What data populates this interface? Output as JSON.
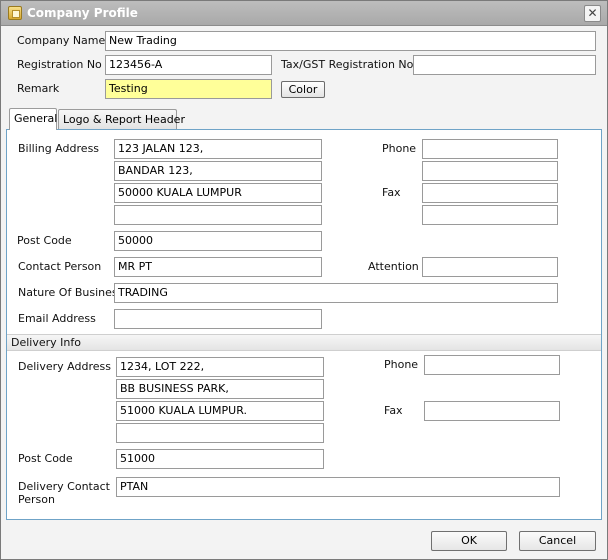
{
  "window": {
    "title": "Company Profile",
    "close_glyph": "✕"
  },
  "header": {
    "company_name_label": "Company Name",
    "company_name_value": "New Trading",
    "registration_no_label": "Registration No",
    "registration_no_value": "123456-A",
    "tax_gst_label": "Tax/GST Registration No",
    "tax_gst_value": "",
    "remark_label": "Remark",
    "remark_value": "Testing",
    "remark_color": "#ffff99",
    "color_button_label": "Color"
  },
  "tabs": [
    {
      "label": "General",
      "active": true
    },
    {
      "label": "Logo & Report Header",
      "active": false
    }
  ],
  "general": {
    "billing_address_label": "Billing Address",
    "billing_address_lines": [
      "123 JALAN  123,",
      "BANDAR 123,",
      "50000 KUALA LUMPUR",
      ""
    ],
    "phone_label": "Phone",
    "phone_values": [
      "",
      ""
    ],
    "fax_label": "Fax",
    "fax_values": [
      "",
      ""
    ],
    "post_code_label": "Post Code",
    "post_code_value": "50000",
    "contact_person_label": "Contact Person",
    "contact_person_value": "MR PT",
    "attention_label": "Attention",
    "attention_value": "",
    "nature_of_business_label": "Nature Of Business",
    "nature_of_business_value": "TRADING",
    "email_address_label": "Email Address",
    "email_address_value": ""
  },
  "delivery": {
    "section_title": "Delivery Info",
    "delivery_address_label": "Delivery Address",
    "delivery_address_lines": [
      "1234, LOT 222,",
      "BB BUSINESS PARK,",
      "51000 KUALA LUMPUR.",
      ""
    ],
    "phone_label": "Phone",
    "phone_value": "",
    "fax_label": "Fax",
    "fax_value": "",
    "post_code_label": "Post Code",
    "post_code_value": "51000",
    "contact_person_label_line1": "Delivery Contact",
    "contact_person_label_line2": "Person",
    "contact_person_value": "PTAN"
  },
  "footer": {
    "ok_label": "OK",
    "cancel_label": "Cancel"
  },
  "colors": {
    "panel_border": "#6fa3c7",
    "titlebar": "#a9a9a9"
  }
}
